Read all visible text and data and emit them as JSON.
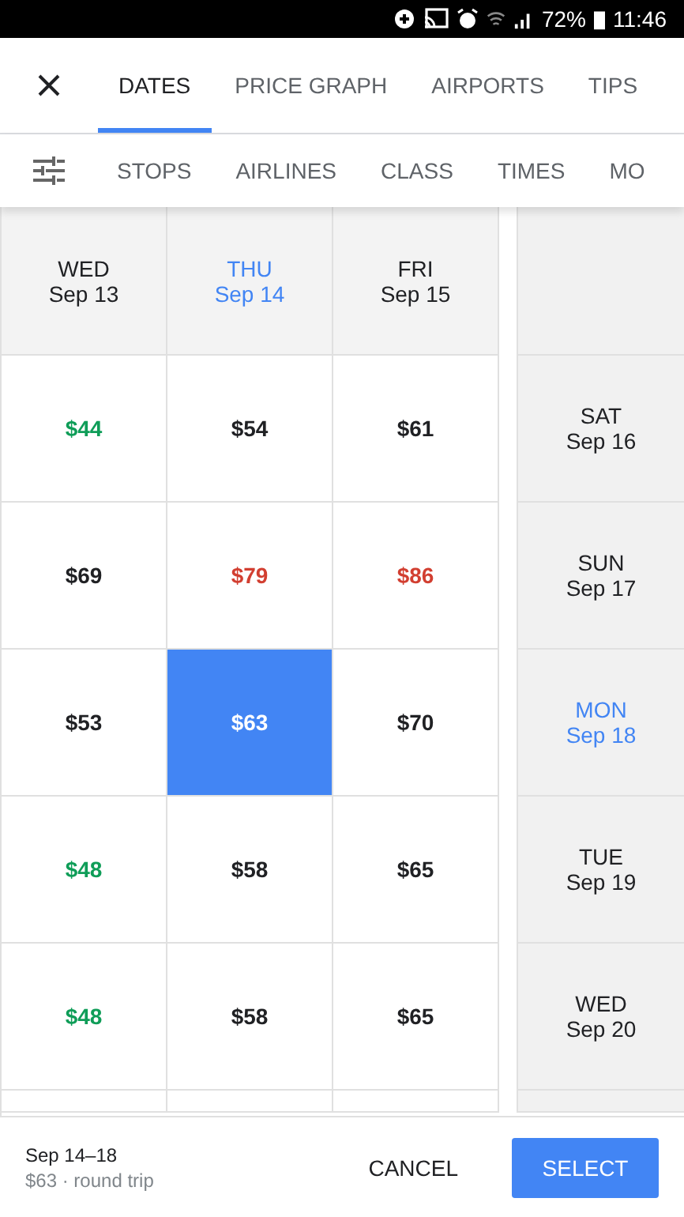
{
  "status_bar": {
    "battery": "72%",
    "time": "11:46"
  },
  "tabs": [
    {
      "label": "DATES",
      "selected": true
    },
    {
      "label": "PRICE GRAPH",
      "selected": false
    },
    {
      "label": "AIRPORTS",
      "selected": false
    },
    {
      "label": "TIPS",
      "selected": false
    }
  ],
  "filters": [
    "STOPS",
    "AIRLINES",
    "CLASS",
    "TIMES",
    "MO"
  ],
  "departure_dates": [
    {
      "day": "WED",
      "date": "Sep 13",
      "selected": false
    },
    {
      "day": "THU",
      "date": "Sep 14",
      "selected": true
    },
    {
      "day": "FRI",
      "date": "Sep 15",
      "selected": false
    }
  ],
  "rows": [
    {
      "day": "SAT",
      "date": "Sep 16",
      "selected": false,
      "prices": [
        {
          "price": "$44",
          "color": "#0f9d58",
          "selected": false
        },
        {
          "price": "$54",
          "color": "#202124",
          "selected": false
        },
        {
          "price": "$61",
          "color": "#202124",
          "selected": false
        }
      ]
    },
    {
      "day": "SUN",
      "date": "Sep 17",
      "selected": false,
      "prices": [
        {
          "price": "$69",
          "color": "#202124",
          "selected": false
        },
        {
          "price": "$79",
          "color": "#d23f31",
          "selected": false
        },
        {
          "price": "$86",
          "color": "#d23f31",
          "selected": false
        }
      ]
    },
    {
      "day": "MON",
      "date": "Sep 18",
      "selected": true,
      "prices": [
        {
          "price": "$53",
          "color": "#202124",
          "selected": false
        },
        {
          "price": "$63",
          "selected": true
        },
        {
          "price": "$70",
          "color": "#202124",
          "selected": false
        }
      ]
    },
    {
      "day": "TUE",
      "date": "Sep 19",
      "selected": false,
      "prices": [
        {
          "price": "$48",
          "color": "#0f9d58",
          "selected": false
        },
        {
          "price": "$58",
          "color": "#202124",
          "selected": false
        },
        {
          "price": "$65",
          "color": "#202124",
          "selected": false
        }
      ]
    },
    {
      "day": "WED",
      "date": "Sep 20",
      "selected": false,
      "prices": [
        {
          "price": "$48",
          "color": "#0f9d58",
          "selected": false
        },
        {
          "price": "$58",
          "color": "#202124",
          "selected": false
        },
        {
          "price": "$65",
          "color": "#202124",
          "selected": false
        }
      ]
    }
  ],
  "summary": {
    "dates": "Sep 14–18",
    "price": "$63 · round trip"
  },
  "buttons": {
    "cancel": "CANCEL",
    "select": "SELECT"
  }
}
